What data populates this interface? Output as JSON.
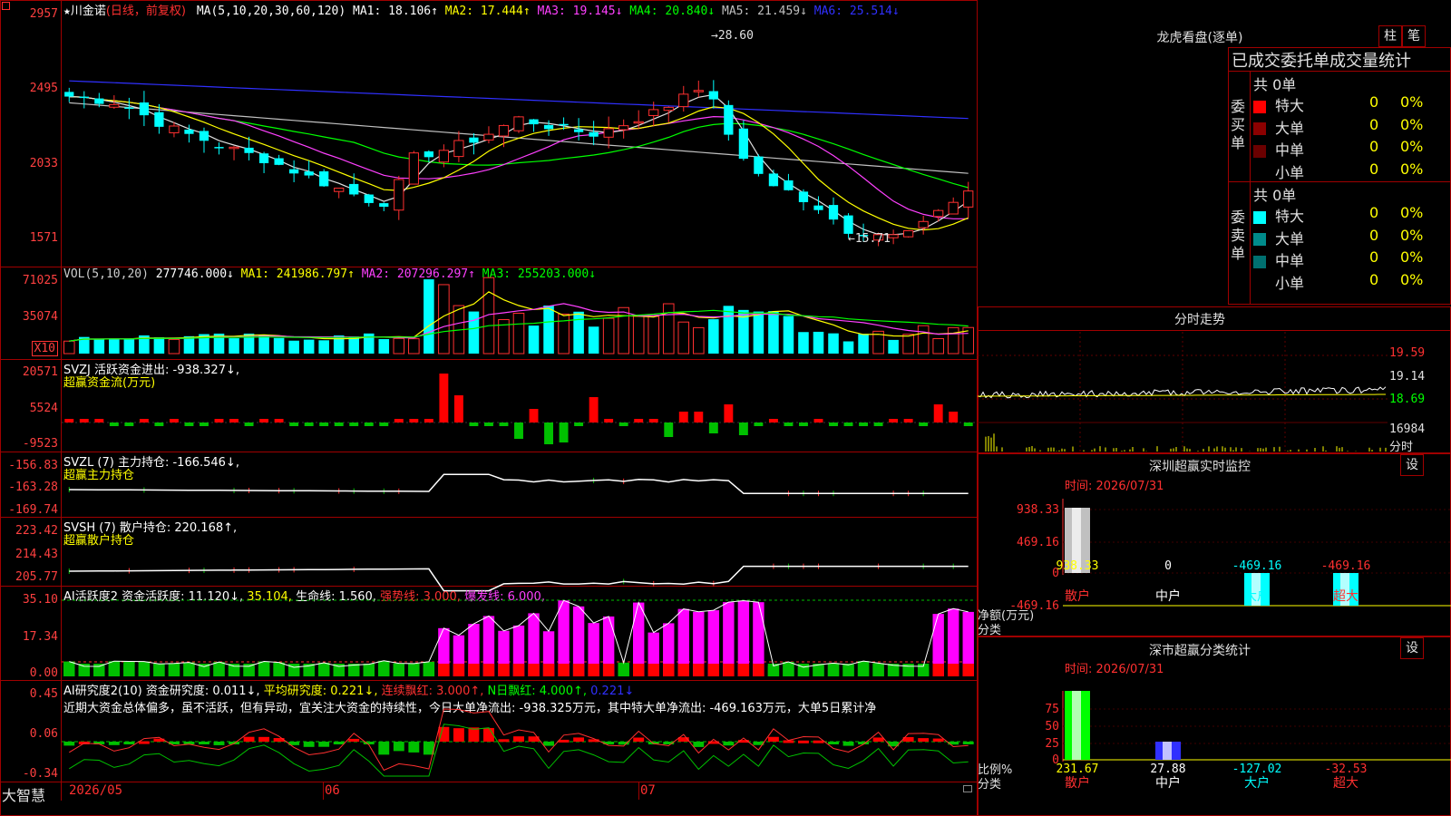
{
  "stock": {
    "star": "★",
    "name": "川金诺",
    "period": "(日线，前复权)",
    "ma_params": "MA(5,10,20,30,60,120)",
    "ma_values": [
      {
        "label": "MA1: 18.106↑",
        "color": "#ffffff"
      },
      {
        "label": "MA2: 17.444↑",
        "color": "#ffff00"
      },
      {
        "label": "MA3: 19.145↓",
        "color": "#ff40ff"
      },
      {
        "label": "MA4: 20.840↓",
        "color": "#00ff00"
      },
      {
        "label": "MA5: 21.459↓",
        "color": "#c0c0c0"
      },
      {
        "label": "MA6: 25.514↓",
        "color": "#3030ff"
      }
    ],
    "price_axis": [
      "2957",
      "2495",
      "2033",
      "1571"
    ],
    "high_label": "28.60",
    "low_label": "15.71"
  },
  "volume": {
    "title": "VOL(5,10,20)",
    "value": "277746.000↓",
    "ma1": "MA1: 241986.797↑",
    "ma2": "MA2: 207296.297↑",
    "ma3": "MA3: 255203.000↓",
    "axis": [
      "71025",
      "35074"
    ],
    "unit": "X10"
  },
  "svzj": {
    "title": "SVZJ  活跃资金进出: -938.327↓,",
    "subtitle": "超赢资金流(万元)",
    "axis": [
      "20571",
      "5524",
      "-9523"
    ]
  },
  "svzl": {
    "title": "SVZL (7) 主力持仓: -166.546↓,",
    "subtitle": "超赢主力持仓",
    "axis": [
      "-156.83",
      "-163.28",
      "-169.74"
    ]
  },
  "svsh": {
    "title": "SVSH (7) 散户持仓: 220.168↑,",
    "subtitle": "超赢散户持仓",
    "axis": [
      "223.42",
      "214.43",
      "205.77"
    ]
  },
  "ai_active": {
    "title": "AI活跃度2 资金活跃度: 11.120↓,",
    "v2": "35.104,",
    "life": "生命线: 1.560,",
    "strong": "强势线: 3.000,",
    "burst": "爆发线: 6.000,",
    "axis": [
      "35.10",
      "17.34",
      "0.00"
    ]
  },
  "ai_research": {
    "title": "AI研究度2(10) 资金研究度: 0.011↓,",
    "avg": "平均研究度: 0.221↓,",
    "cont": "连续飘红: 3.000↑,",
    "nday": "N日飘红: 4.000↑,",
    "last": "0.221↓",
    "comment": "近期大资金总体偏多，虽不活跃，但有异动，宜关注大资金的持续性，今日大单净流出: -938.325万元，其中特大单净流出: -469.163万元，大单5日累计净",
    "axis": [
      "0.45",
      "0.06",
      "-0.34"
    ]
  },
  "bottom": {
    "brand": "大智慧",
    "dates": [
      "2026/05",
      "06",
      "07"
    ]
  },
  "lhb": {
    "title": "龙虎看盘(逐单)",
    "btn1": "柱",
    "btn2": "笔",
    "stat_title": "已成交委托单成交量统计",
    "buy_label": "委买单",
    "sell_label": "委卖单",
    "buy_total": "共 0单",
    "sell_total": "共 0单",
    "buy_rows": [
      {
        "name": "特大",
        "count": "0",
        "pct": "0%",
        "color": "#ff0000"
      },
      {
        "name": "大单",
        "count": "0",
        "pct": "0%",
        "color": "#8b0000"
      },
      {
        "name": "中单",
        "count": "0",
        "pct": "0%",
        "color": "#6b0000"
      },
      {
        "name": "小单",
        "count": "0",
        "pct": "0%",
        "color": ""
      }
    ],
    "sell_rows": [
      {
        "name": "特大",
        "count": "0",
        "pct": "0%",
        "color": "#00ffff"
      },
      {
        "name": "大单",
        "count": "0",
        "pct": "0%",
        "color": "#008b8b"
      },
      {
        "name": "中单",
        "count": "0",
        "pct": "0%",
        "color": "#007070"
      },
      {
        "name": "小单",
        "count": "0",
        "pct": "0%",
        "color": ""
      }
    ]
  },
  "fenshi": {
    "title": "分时走势",
    "axis": [
      "19.59",
      "19.14",
      "18.69",
      "16984"
    ],
    "unit": "分时"
  },
  "monitor": {
    "title": "深圳超赢实时监控",
    "btn": "设",
    "time": "时间: 2026/07/31",
    "axis": [
      "938.33",
      "469.16",
      "0",
      "-469.16"
    ],
    "values": [
      "938.33",
      "0",
      "-469.16",
      "-469.16"
    ],
    "ylabel": "净额(万元)",
    "xlabel": "分类",
    "cats": [
      "散户",
      "中户",
      "大户",
      "超大"
    ]
  },
  "classify": {
    "title": "深市超赢分类统计",
    "btn": "设",
    "time": "时间: 2026/07/31",
    "axis": [
      "75",
      "50",
      "25",
      "0"
    ],
    "values": [
      "231.67",
      "27.88",
      "-127.02",
      "-32.53"
    ],
    "ylabel": "比例%",
    "xlabel": "分类",
    "cats": [
      "散户",
      "中户",
      "大户",
      "超大"
    ]
  }
}
